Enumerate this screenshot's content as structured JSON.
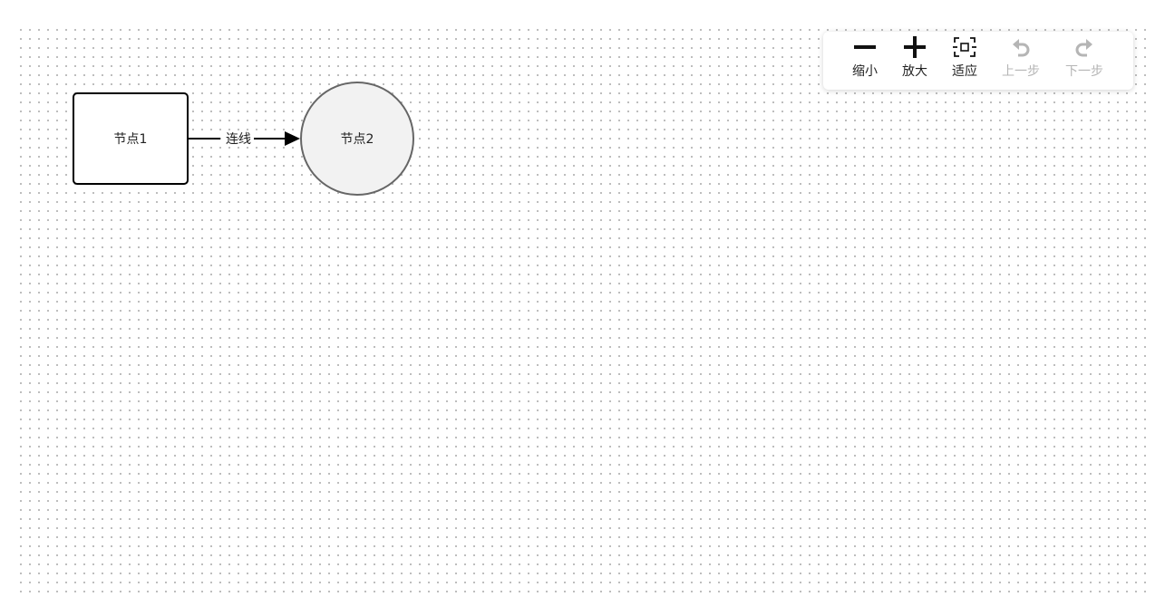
{
  "canvas": {
    "grid": "dotted"
  },
  "nodes": [
    {
      "id": "node-1",
      "shape": "rect",
      "label": "节点1",
      "fill": "#ffffff",
      "stroke": "#000000"
    },
    {
      "id": "node-2",
      "shape": "circle",
      "label": "节点2",
      "fill": "#f2f2f2",
      "stroke": "#666666"
    }
  ],
  "edges": [
    {
      "from": "node-1",
      "to": "node-2",
      "label": "连线",
      "color": "#000000"
    }
  ],
  "toolbar": {
    "items": [
      {
        "id": "zoom-out",
        "label": "缩小",
        "icon": "minus-icon",
        "enabled": true
      },
      {
        "id": "zoom-in",
        "label": "放大",
        "icon": "plus-icon",
        "enabled": true
      },
      {
        "id": "fit",
        "label": "适应",
        "icon": "fit-view-icon",
        "enabled": true
      },
      {
        "id": "undo",
        "label": "上一步",
        "icon": "undo-icon",
        "enabled": false
      },
      {
        "id": "redo",
        "label": "下一步",
        "icon": "redo-icon",
        "enabled": false
      }
    ]
  },
  "colors": {
    "enabled_icon": "#111111",
    "disabled_icon": "#b5b5b5"
  }
}
